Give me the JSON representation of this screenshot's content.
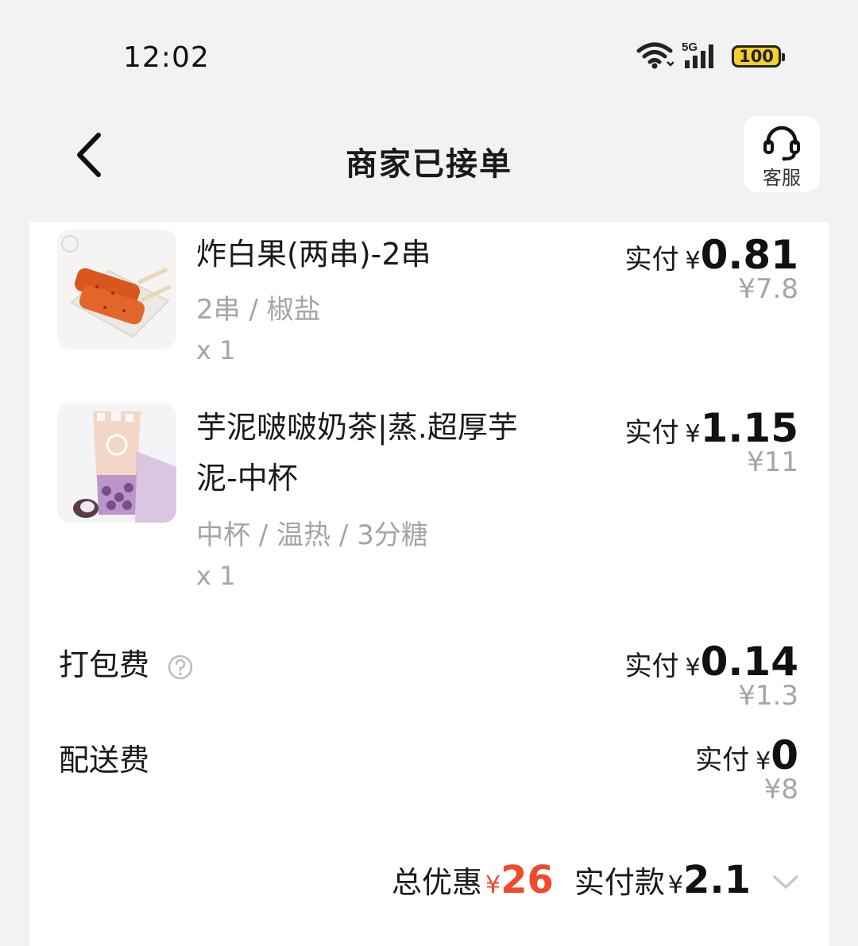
{
  "status_bar": {
    "time": "12:02",
    "network": "5G",
    "battery": "100",
    "icons": [
      "wifi-icon",
      "signal-icon",
      "battery-icon"
    ]
  },
  "header": {
    "title": "商家已接单",
    "service_label": "客服",
    "back_icon": "chevron-left-icon",
    "service_icon": "headset-icon"
  },
  "items": [
    {
      "name": "炸白果(两串)-2串",
      "spec": "2串 / 椒盐",
      "qty": "x 1",
      "paid_label": "实付",
      "yen": "¥",
      "paid": "0.81",
      "original": "¥7.8"
    },
    {
      "name_line1": "芋泥啵啵奶茶|蒸.超厚芋",
      "name_line2": "泥-中杯",
      "spec": "中杯 / 温热 / 3分糖",
      "qty": "x 1",
      "paid_label": "实付",
      "yen": "¥",
      "paid": "1.15",
      "original": "¥11"
    }
  ],
  "fees": [
    {
      "label": "打包费",
      "paid_label": "实付",
      "yen": "¥",
      "paid": "0.14",
      "original": "¥1.3",
      "help_icon": "question-circle-icon"
    },
    {
      "label": "配送费",
      "paid_label": "实付",
      "yen": "¥",
      "paid": "0",
      "original": "¥8"
    }
  ],
  "summary": {
    "discount_label": "总优惠",
    "yen": "¥",
    "discount_value": "26",
    "paid_label": "实付款",
    "paid_value": "2.1",
    "expand_icon": "chevron-down-icon"
  },
  "colors": {
    "accent": "#ee4a2b",
    "background": "#f2f2f2",
    "muted_text": "#a5a5a5"
  }
}
